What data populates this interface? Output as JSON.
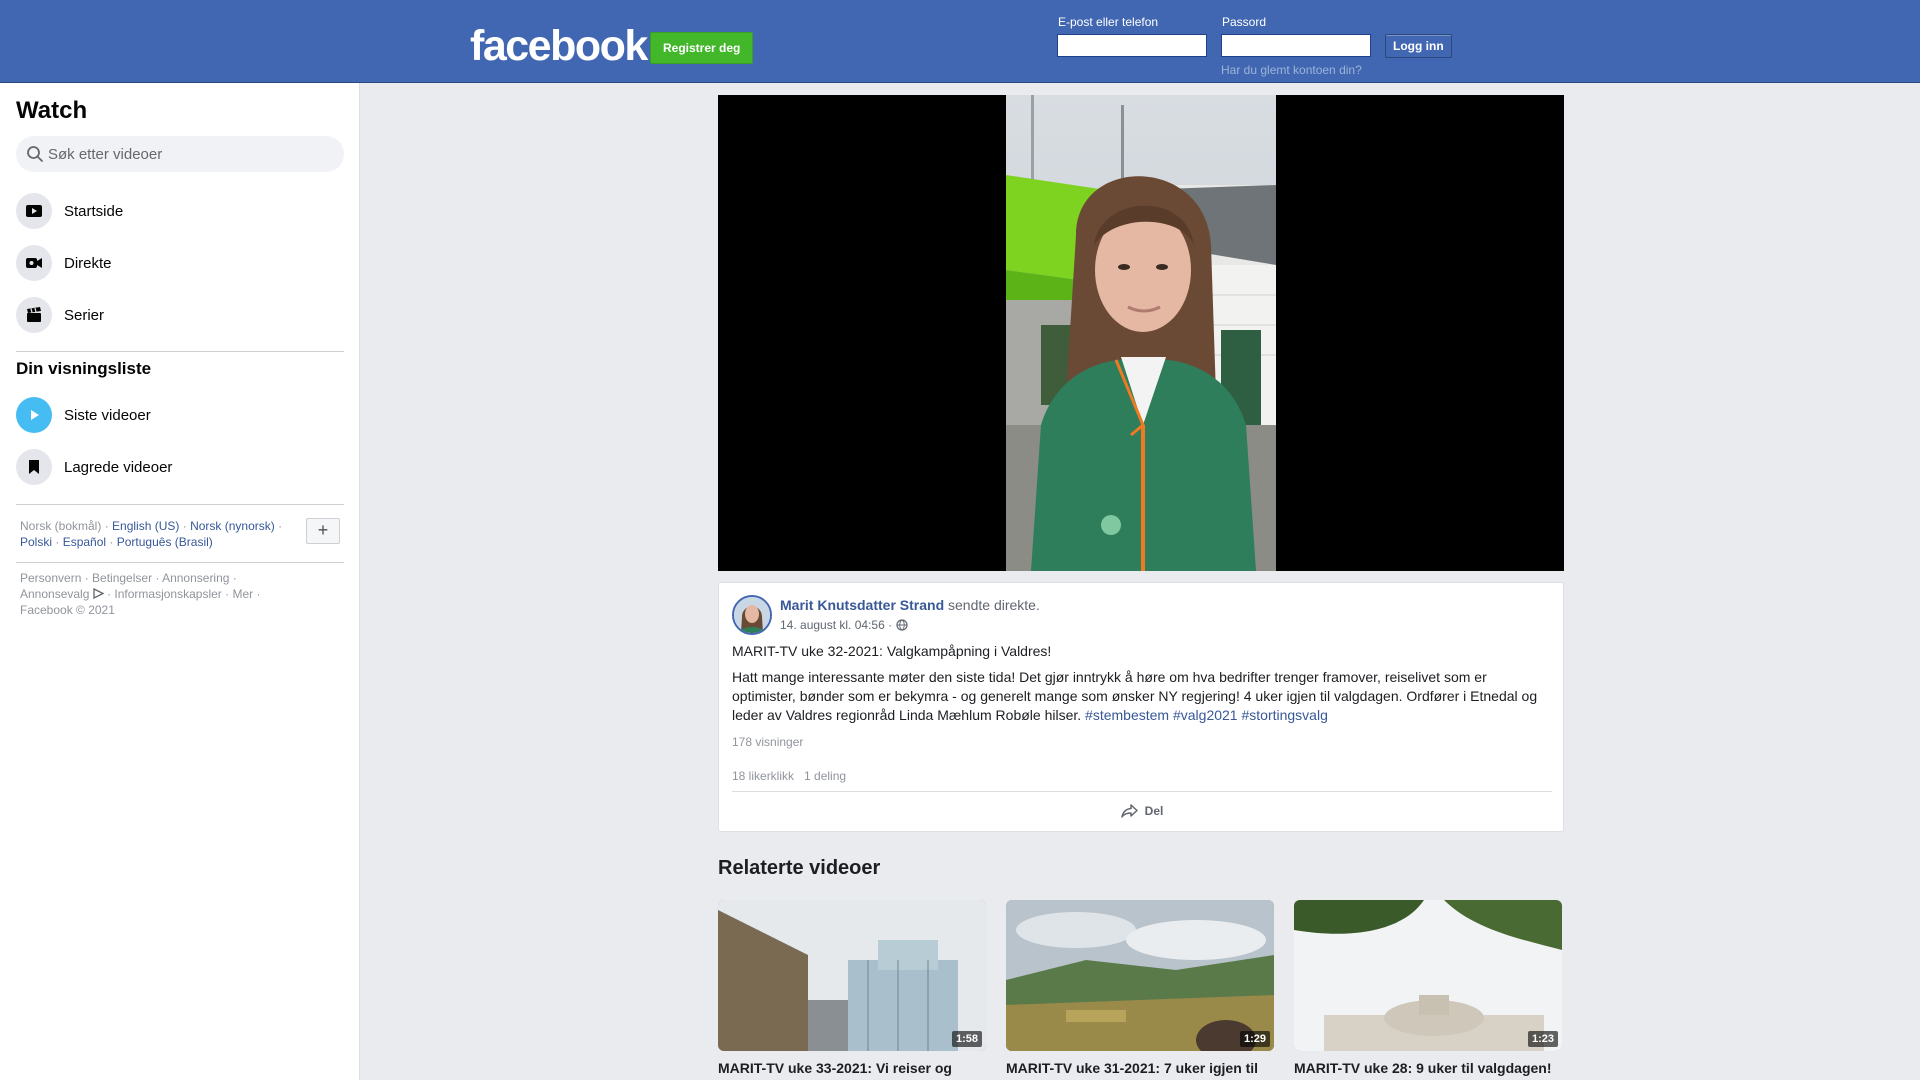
{
  "header": {
    "logo": "facebook",
    "register_label": "Registrer deg",
    "email_label": "E-post eller telefon",
    "password_label": "Passord",
    "login_label": "Logg inn",
    "forgot_label": "Har du glemt kontoen din?",
    "brand_color": "#4267b2"
  },
  "sidebar": {
    "title": "Watch",
    "search_placeholder": "Søk etter videoer",
    "nav": [
      {
        "label": "Startside",
        "icon": "play-screen-icon"
      },
      {
        "label": "Direkte",
        "icon": "live-camera-icon"
      },
      {
        "label": "Serier",
        "icon": "clapperboard-icon"
      }
    ],
    "watchlist_title": "Din visningsliste",
    "watchlist": [
      {
        "label": "Siste videoer",
        "icon": "play-circle-icon"
      },
      {
        "label": "Lagrede videoer",
        "icon": "bookmark-icon"
      }
    ],
    "languages": {
      "current": "Norsk (bokmål)",
      "links": [
        "English (US)",
        "Norsk (nynorsk)",
        "Polski",
        "Español",
        "Português (Brasil)"
      ],
      "more": "+"
    },
    "footer": {
      "line1": "Personvern · Betingelser · Annonsering ·",
      "adchoices": "Annonsevalg",
      "line2": " · Informasjonskapsler · Mer ·",
      "copyright": "Facebook © 2021"
    }
  },
  "post": {
    "author": "Marit Knutsdatter Strand",
    "action": "sendte direkte.",
    "date": "14. august kl. 04:56 ·",
    "title": "MARIT-TV uke 32-2021: Valgkampåpning i Valdres!",
    "body": "Hatt mange interessante møter den siste tida! Det gjør inntrykk å høre om hva bedrifter trenger framover, reiselivet som er optimister, bønder som er bekymra - og generelt mange som ønsker NY regjering! 4 uker igjen til valgdagen. Ordfører i Etnedal og leder av Valdres regionråd Linda Mæhlum Robøle hilser.",
    "hashtags": [
      "#stembestem",
      "#valg2021",
      "#stortingsvalg"
    ],
    "views": "178 visninger",
    "likes": "18 likerklikk",
    "shares": "1 deling",
    "share_label": "Del"
  },
  "related": {
    "title": "Relaterte videoer",
    "videos": [
      {
        "title": "MARIT-TV uke 33-2021: Vi reiser og",
        "duration": "1:58"
      },
      {
        "title": "MARIT-TV uke 31-2021: 7 uker igjen til",
        "duration": "1:29"
      },
      {
        "title": "MARIT-TV uke 28: 9 uker til valgdagen!",
        "duration": "1:23"
      }
    ]
  }
}
